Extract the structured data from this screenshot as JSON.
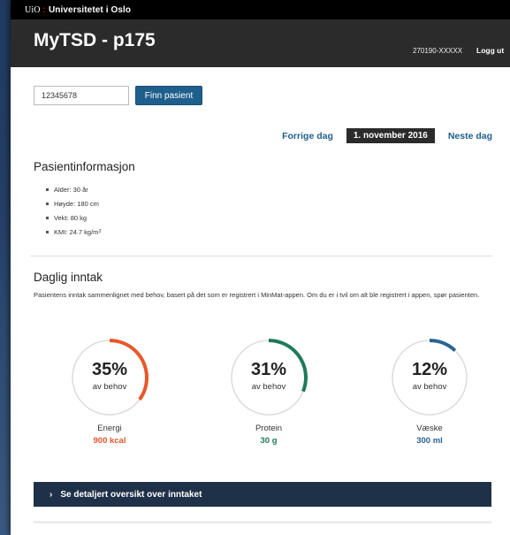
{
  "banner": {
    "logo": "UiO",
    "separator": ":",
    "name": "Universitetet i Oslo"
  },
  "header": {
    "title": "MyTSD - p175",
    "user_id": "270190-XXXXX",
    "logout_label": "Logg ut"
  },
  "search": {
    "value": "12345678",
    "button_label": "Finn pasient"
  },
  "date_nav": {
    "prev_label": "Forrige dag",
    "current_date": "1. november 2016",
    "next_label": "Neste dag"
  },
  "patient": {
    "heading": "Pasientinformasjon",
    "age": "Alder: 30 år",
    "height": "Høyde: 180 cm",
    "weight": "Vekt: 80 kg",
    "bmi_prefix": "KMI: 24.7 kg/m",
    "bmi_exp": "2"
  },
  "intake": {
    "heading": "Daglig inntak",
    "description": "Pasientens inntak sammenlignet med behov, basert på det som er registrert i MinMat-appen. Om du er i tvil om alt ble registrert i appen, spør pasienten.",
    "sub_label": "av behov",
    "gauges": [
      {
        "percent": 35,
        "percent_label": "35%",
        "name": "Energi",
        "value": "900 kcal",
        "color": "#e8572a"
      },
      {
        "percent": 31,
        "percent_label": "31%",
        "name": "Protein",
        "value": "30 g",
        "color": "#1f7a5a"
      },
      {
        "percent": 12,
        "percent_label": "12%",
        "name": "Væske",
        "value": "300 ml",
        "color": "#2a6496"
      }
    ]
  },
  "details": {
    "label": "Se detaljert oversikt over inntaket"
  }
}
